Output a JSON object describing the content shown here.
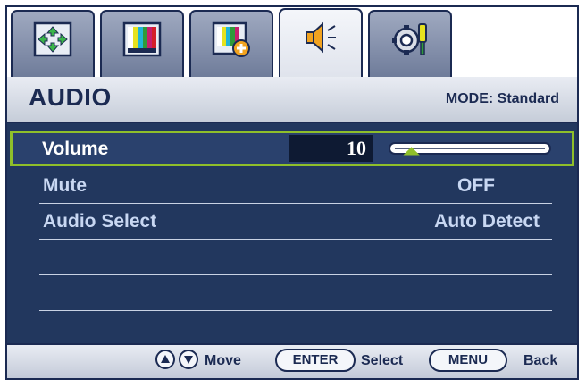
{
  "tabs": [
    {
      "icon": "display-adjust-icon",
      "active": false
    },
    {
      "icon": "picture-icon",
      "active": false
    },
    {
      "icon": "picture-advanced-icon",
      "active": false
    },
    {
      "icon": "speaker-icon",
      "active": true
    },
    {
      "icon": "system-settings-icon",
      "active": false
    }
  ],
  "header": {
    "title": "AUDIO",
    "mode": "MODE: Standard"
  },
  "menu": {
    "items": [
      {
        "label": "Volume",
        "value": "10",
        "selected": true
      },
      {
        "label": "Mute",
        "value": "OFF",
        "selected": false
      },
      {
        "label": "Audio Select",
        "value": "Auto Detect",
        "selected": false
      }
    ],
    "volume_level": 0.1
  },
  "footer": {
    "move_label": "Move",
    "enter_label": "ENTER",
    "select_label": "Select",
    "menu_label": "MENU",
    "back_label": "Back"
  },
  "colors": {
    "body": "#22375e",
    "frame": "#1b2a52",
    "highlight": "#8fbf2a",
    "slider_thumb": "#8fbf2a"
  }
}
